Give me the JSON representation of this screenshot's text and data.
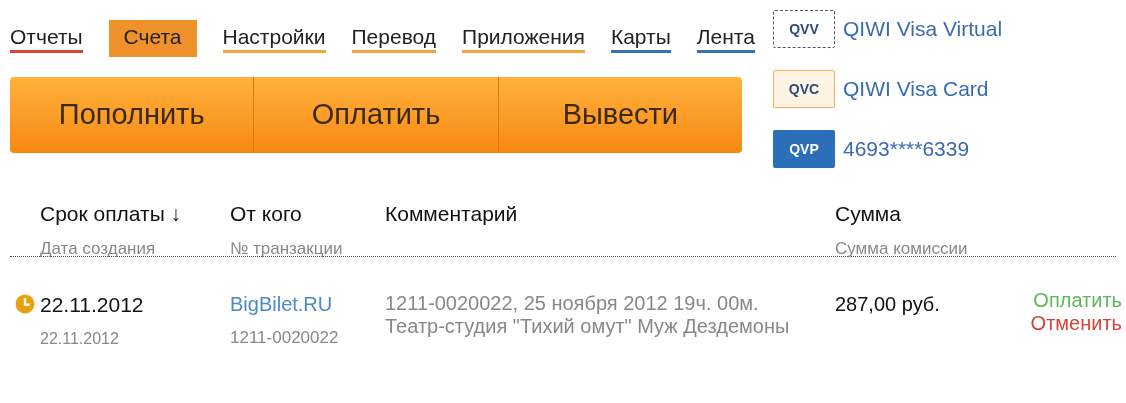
{
  "nav": [
    {
      "label": "Отчеты",
      "selected": false,
      "color": "#d9413a"
    },
    {
      "label": "Счета",
      "selected": true,
      "color": "#f0922a"
    },
    {
      "label": "Настройки",
      "selected": false,
      "color": "#f0a53a"
    },
    {
      "label": "Перевод",
      "selected": false,
      "color": "#f0a53a"
    },
    {
      "label": "Приложения",
      "selected": false,
      "color": "#f0a53a"
    },
    {
      "label": "Карты",
      "selected": false,
      "color": "#3a6eb5"
    },
    {
      "label": "Лента",
      "selected": false,
      "color": "#3a6eb5"
    }
  ],
  "actions": [
    "Пополнить",
    "Оплатить",
    "Вывести"
  ],
  "cards": [
    {
      "kind": "virtual",
      "badge": "QVV",
      "label": "QIWI Visa Virtual"
    },
    {
      "kind": "card",
      "badge": "QVC",
      "label": "QIWI Visa Card"
    },
    {
      "kind": "plastic",
      "badge": "QVP",
      "label": "4693****6339"
    }
  ],
  "table": {
    "columns": [
      {
        "title": "Срок оплаты ↓",
        "subtitle": "Дата создания"
      },
      {
        "title": "От кого",
        "subtitle": "№ транзакции"
      },
      {
        "title": "Комментарий"
      },
      {
        "title": "Сумма",
        "subtitle": "Сумма комиссии"
      }
    ],
    "rows": [
      {
        "due": "22.11.2012",
        "created": "22.11.2012",
        "from": "BigBilet.RU",
        "transaction": "1211-0020022",
        "comment": "1211-0020022, 25 ноября 2012 19ч. 00м. Театр-студия \"Тихий омут\" Муж Дездемоны",
        "amount": "287,00 руб.",
        "pay": "Оплатить",
        "cancel": "Отменить"
      }
    ]
  }
}
